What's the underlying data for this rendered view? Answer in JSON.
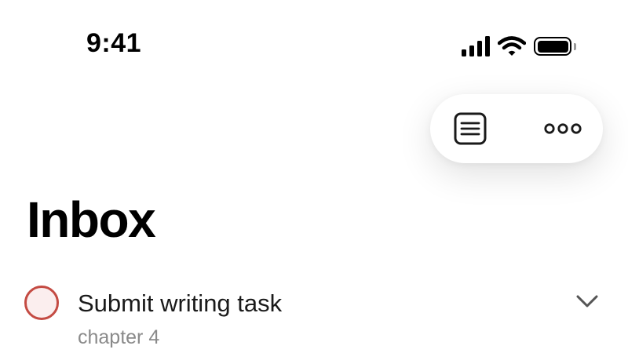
{
  "status_bar": {
    "time": "9:41",
    "icons": [
      "cellular-signal-icon",
      "wifi-icon",
      "battery-icon"
    ]
  },
  "toolbar": {
    "buttons": [
      {
        "name": "list-view-icon"
      },
      {
        "name": "more-options-icon"
      }
    ]
  },
  "page": {
    "title": "Inbox"
  },
  "tasks": [
    {
      "title": "Submit writing task",
      "subtitle": "chapter 4",
      "checkbox_color": "#c44b43",
      "checkbox_fill": "#fbeeee",
      "completed": false
    }
  ],
  "colors": {
    "background": "#ffffff",
    "text": "#111111",
    "secondary_text": "#8a8a8a",
    "priority_red": "#c44b43"
  }
}
